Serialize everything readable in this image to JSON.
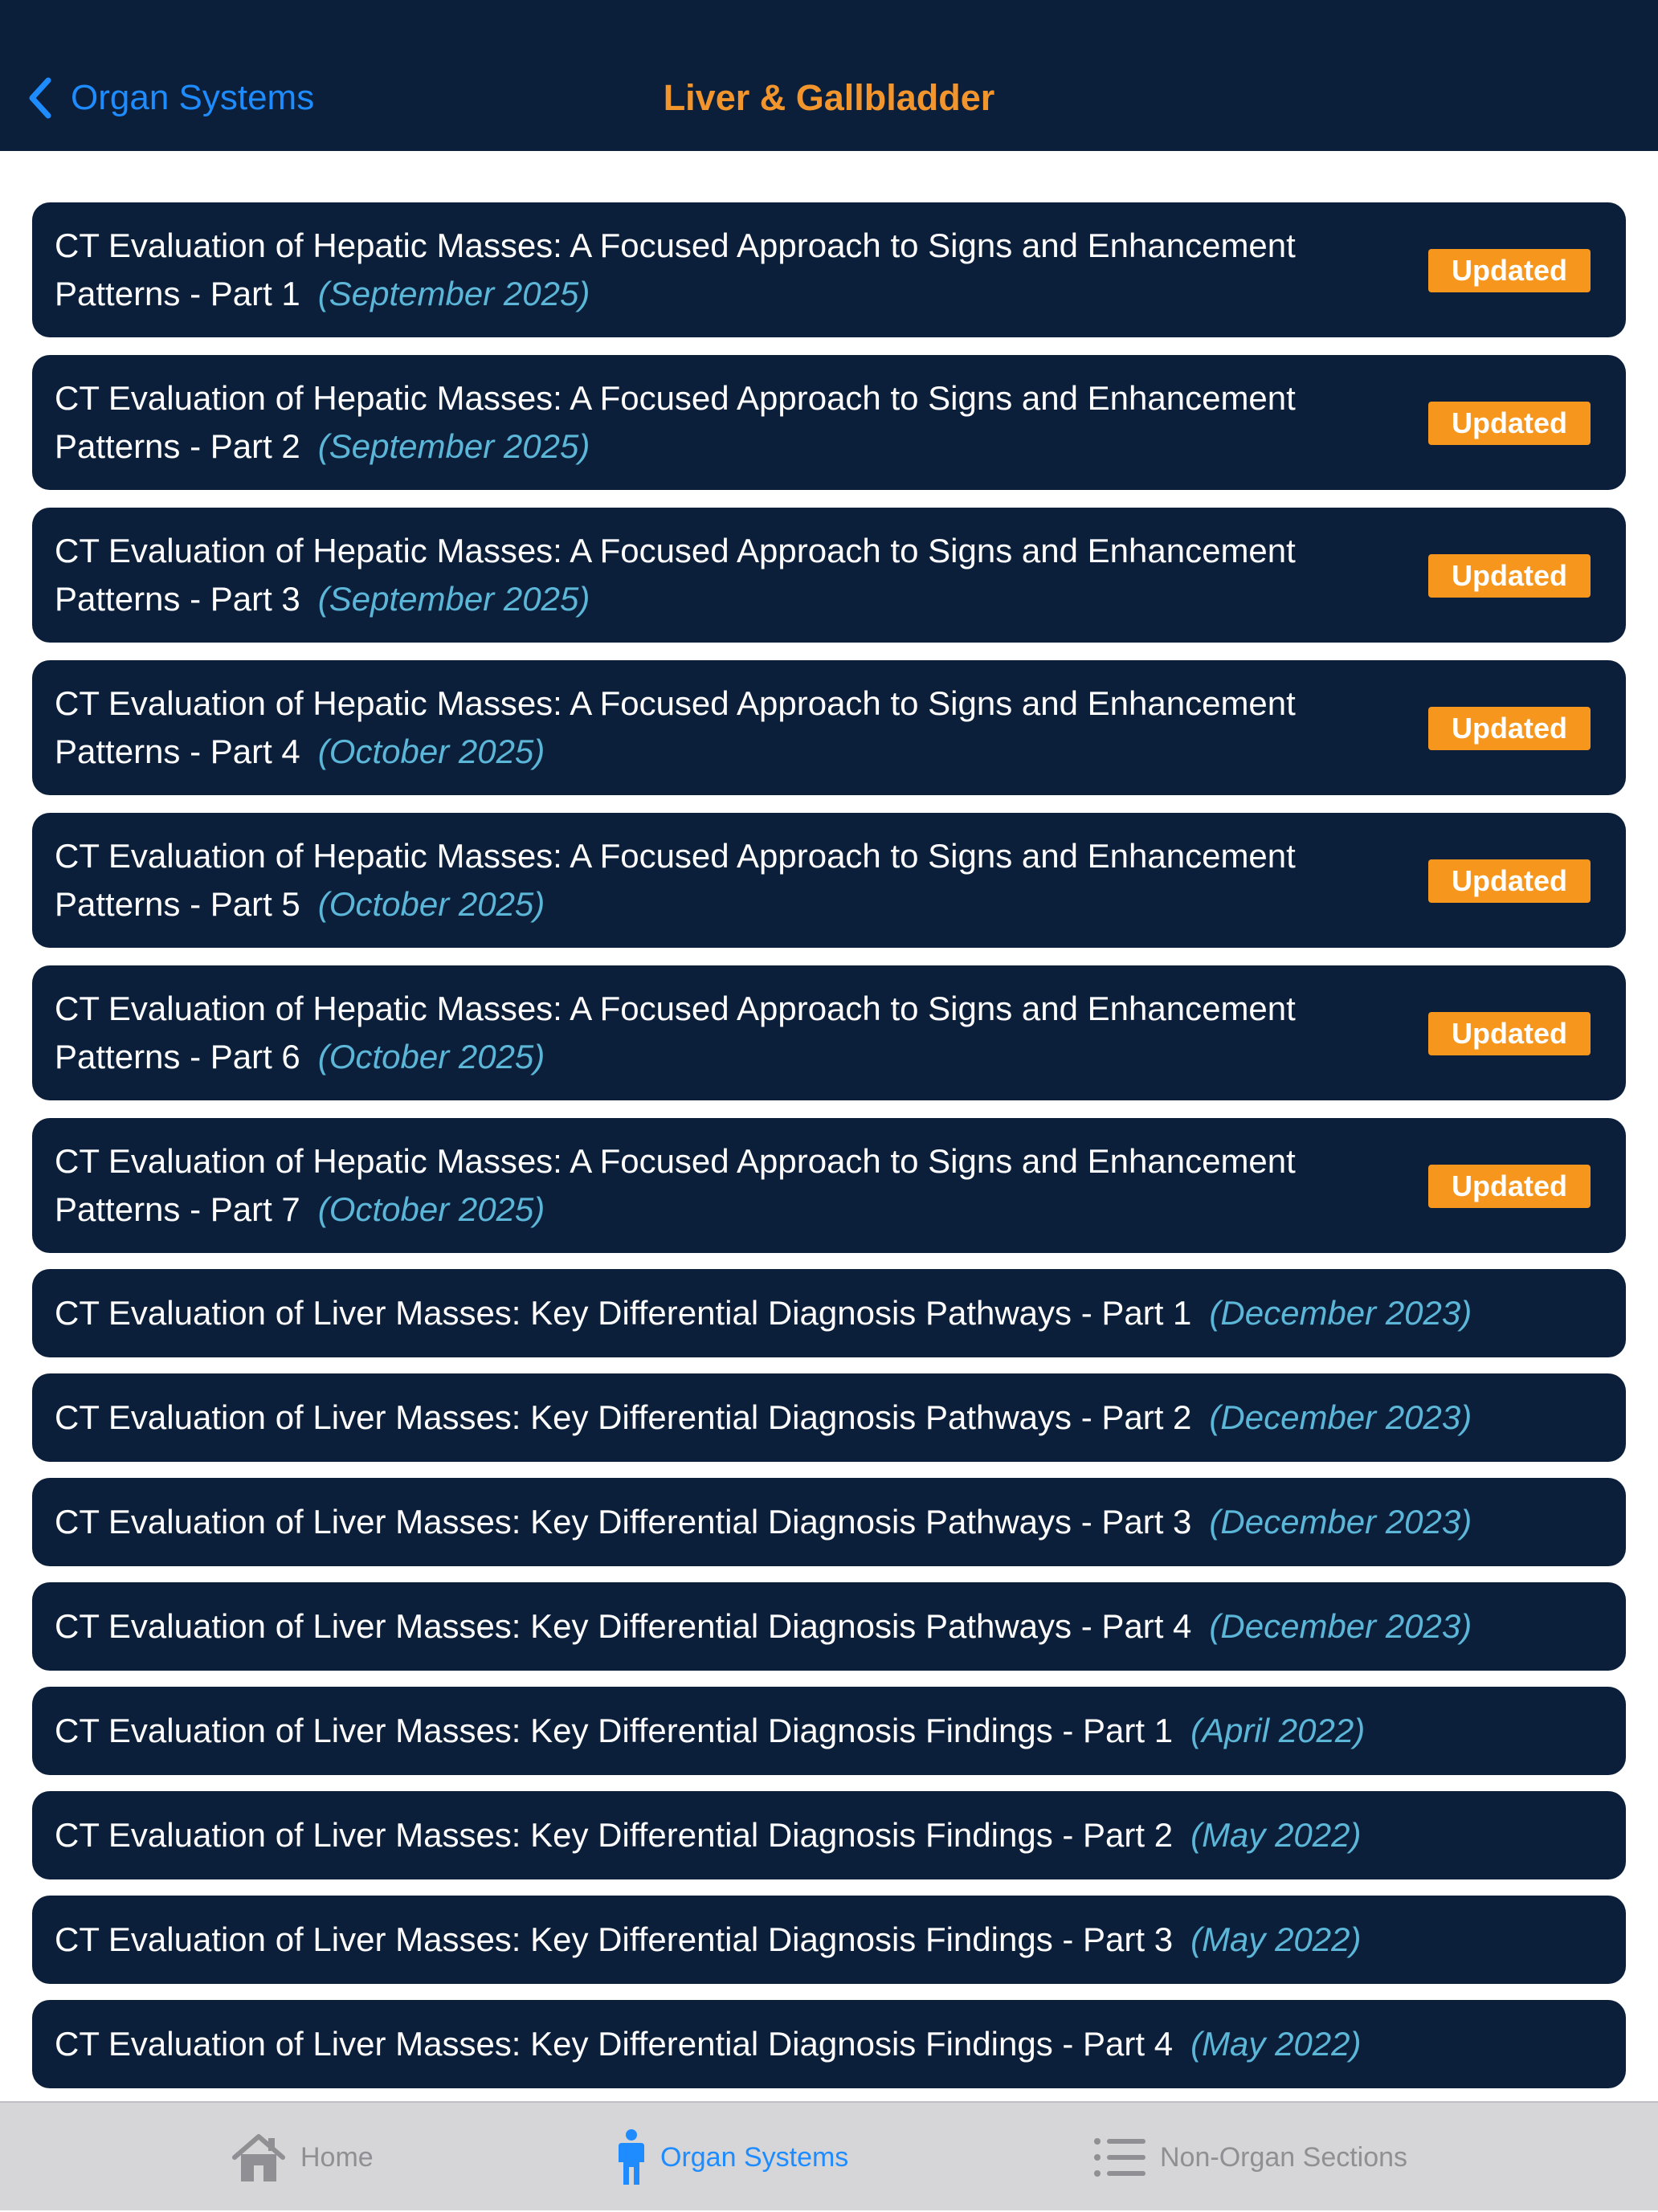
{
  "nav": {
    "back_label": "Organ Systems",
    "title": "Liver & Gallbladder"
  },
  "colors": {
    "nav_background": "#0c1f3a",
    "accent_blue": "#1e8cff",
    "title_orange": "#f2952c",
    "badge_orange": "#f7961d",
    "date_cyan": "#5cb6d8"
  },
  "list": {
    "items": [
      {
        "title": "CT Evaluation of Hepatic Masses: A Focused Approach to Signs and Enhancement Patterns - Part 1",
        "date": "(September 2025)",
        "badge": "Updated"
      },
      {
        "title": "CT Evaluation of Hepatic Masses: A Focused Approach to Signs and Enhancement Patterns - Part 2",
        "date": "(September 2025)",
        "badge": "Updated"
      },
      {
        "title": "CT Evaluation of Hepatic Masses: A Focused Approach to Signs and Enhancement Patterns - Part 3",
        "date": "(September 2025)",
        "badge": "Updated"
      },
      {
        "title": "CT Evaluation of Hepatic Masses: A Focused Approach to Signs and Enhancement Patterns - Part 4",
        "date": "(October 2025)",
        "badge": "Updated"
      },
      {
        "title": "CT Evaluation of Hepatic Masses: A Focused Approach to Signs and Enhancement Patterns - Part 5",
        "date": "(October 2025)",
        "badge": "Updated"
      },
      {
        "title": "CT Evaluation of Hepatic Masses: A Focused Approach to Signs and Enhancement Patterns - Part 6",
        "date": "(October 2025)",
        "badge": "Updated"
      },
      {
        "title": "CT Evaluation of Hepatic Masses: A Focused Approach to Signs and Enhancement Patterns - Part 7",
        "date": "(October 2025)",
        "badge": "Updated"
      },
      {
        "title": "CT Evaluation of Liver Masses: Key Differential Diagnosis Pathways - Part 1",
        "date": "(December 2023)"
      },
      {
        "title": "CT Evaluation of Liver Masses: Key Differential Diagnosis Pathways - Part 2",
        "date": "(December 2023)"
      },
      {
        "title": "CT Evaluation of Liver Masses: Key Differential Diagnosis Pathways - Part 3",
        "date": "(December 2023)"
      },
      {
        "title": "CT Evaluation of Liver Masses: Key Differential Diagnosis Pathways - Part 4",
        "date": "(December 2023)"
      },
      {
        "title": "CT Evaluation of Liver Masses: Key Differential Diagnosis Findings - Part 1",
        "date": "(April 2022)"
      },
      {
        "title": "CT Evaluation of Liver Masses: Key Differential Diagnosis Findings - Part 2",
        "date": "(May 2022)"
      },
      {
        "title": "CT Evaluation of Liver Masses: Key Differential Diagnosis Findings - Part 3",
        "date": "(May 2022)"
      },
      {
        "title": "CT Evaluation of Liver Masses: Key Differential Diagnosis Findings - Part 4",
        "date": "(May 2022)"
      }
    ]
  },
  "tab_bar": {
    "tabs": [
      {
        "label": "Home",
        "icon": "house-icon",
        "selected": false
      },
      {
        "label": "Organ Systems",
        "icon": "person-icon",
        "selected": true
      },
      {
        "label": "Non-Organ Sections",
        "icon": "list-icon",
        "selected": false
      }
    ]
  }
}
